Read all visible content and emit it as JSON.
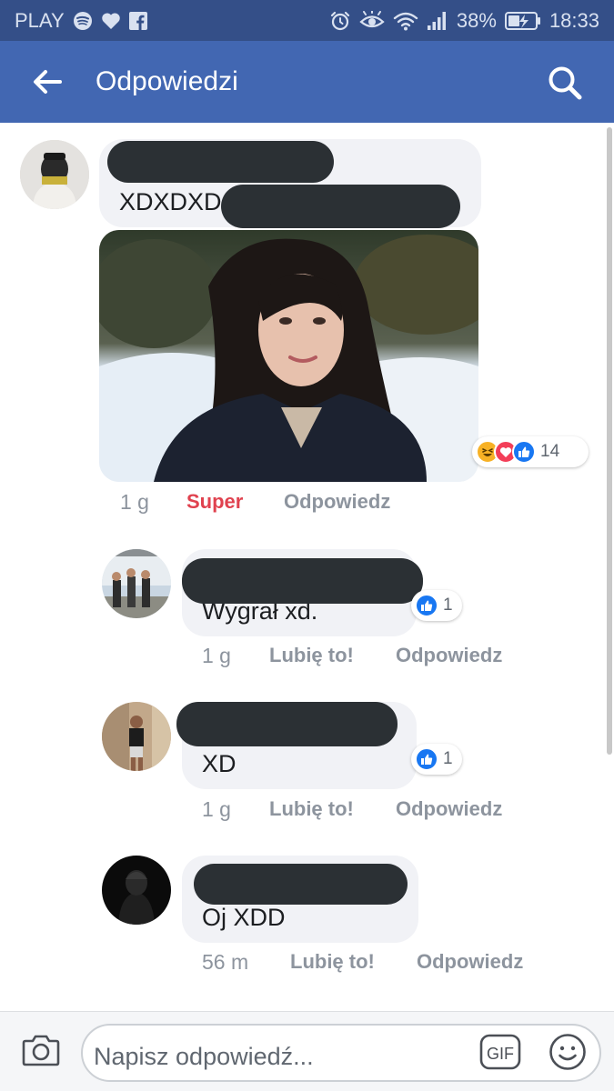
{
  "status_bar": {
    "carrier": "PLAY",
    "left_icons": [
      "spotify-icon",
      "heart-icon",
      "facebook-icon"
    ],
    "right_icons": [
      "alarm-icon",
      "eye-icon",
      "wifi-icon",
      "signal-icon"
    ],
    "battery": "38%",
    "time": "18:33"
  },
  "app_bar": {
    "back_icon": "back-arrow-icon",
    "title": "Odpowiedzi",
    "search_icon": "search-icon"
  },
  "comments": [
    {
      "text": "XDXDXD",
      "has_photo": true,
      "reactions": [
        "haha",
        "love",
        "like"
      ],
      "reaction_count": "14",
      "time": "1 g",
      "reaction_label": "Super",
      "reply_label": "Odpowiedz"
    },
    {
      "text": "Wygrał xd.",
      "reactions": [
        "like"
      ],
      "reaction_count": "1",
      "time": "1 g",
      "like_label": "Lubię to!",
      "reply_label": "Odpowiedz"
    },
    {
      "text": "XD",
      "reactions": [
        "like"
      ],
      "reaction_count": "1",
      "time": "1 g",
      "like_label": "Lubię to!",
      "reply_label": "Odpowiedz"
    },
    {
      "text": "Oj XDD",
      "time": "56 m",
      "like_label": "Lubię to!",
      "reply_label": "Odpowiedz"
    }
  ],
  "composer": {
    "camera_icon": "camera-icon",
    "placeholder": "Napisz odpowiedź...",
    "gif_label": "GIF",
    "emoji_icon": "emoji-icon"
  },
  "colors": {
    "status_bar": "#344f88",
    "app_bar": "#4267b2",
    "bubble": "#f1f2f6",
    "super": "#e0424f",
    "meta": "#8d949e",
    "like_blue": "#1877f2",
    "love_red": "#f33e58",
    "haha_yellow": "#f7b125"
  }
}
